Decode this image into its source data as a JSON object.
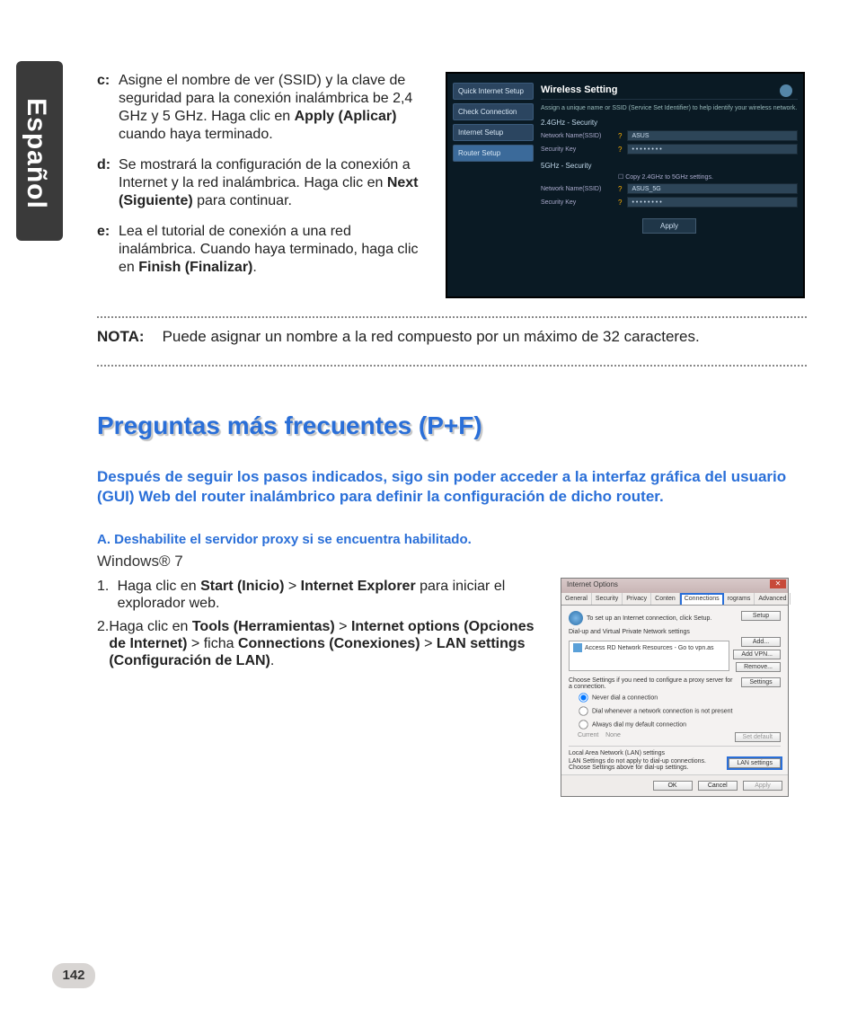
{
  "side_label": "Español",
  "steps": {
    "c_label": "c:",
    "c_text_1": "Asigne el nombre de ver (SSID) y la clave de seguridad para la conexión inalámbrica be 2,4 GHz y 5 GHz. Haga clic en ",
    "c_bold": "Apply (Aplicar)",
    "c_text_2": " cuando haya terminado.",
    "d_label": "d:",
    "d_text_1": "Se mostrará la configuración de la conexión a Internet y la red inalámbrica. Haga clic en ",
    "d_bold": "Next (Siguiente)",
    "d_text_2": " para continuar.",
    "e_label": "e:",
    "e_text_1": "Lea el tutorial de conexión a una red inalámbrica. Cuando haya terminado, haga clic en ",
    "e_bold": "Finish (Finalizar)",
    "e_text_2": "."
  },
  "router": {
    "sb1": "Quick Internet Setup",
    "sb2": "Check Connection",
    "sb3": "Internet Setup",
    "sb4": "Router Setup",
    "title": "Wireless Setting",
    "info": "Assign a unique name or SSID (Service Set Identifier) to help identify your wireless network.",
    "sec24": "2.4GHz - Security",
    "l_ssid": "Network Name(SSID)",
    "v_ssid24": "ASUS",
    "l_key": "Security Key",
    "v_key": "• • • • • • • •",
    "sec5": "5GHz - Security",
    "copy": "Copy 2.4GHz to 5GHz settings.",
    "v_ssid5": "ASUS_5G",
    "apply": "Apply"
  },
  "nota_label": "NOTA:",
  "nota_text": "Puede asignar un nombre a la red compuesto por un máximo de 32 caracteres.",
  "faq_heading": "Preguntas más frecuentes (P+F)",
  "faq_question": "Después de seguir los pasos indicados, sigo sin poder acceder a la interfaz gráfica del usuario (GUI) Web del router inalámbrico para definir la configuración de dicho router.",
  "faq_a": "A.   Deshabilite el servidor proxy si se encuentra habilitado.",
  "win7": "Windows® 7",
  "ol": {
    "n1": "1.",
    "t1a": "Haga clic en ",
    "t1b1": "Start (Inicio)",
    "t1gt1": " > ",
    "t1b2": "Internet Explorer",
    "t1c": " para iniciar el explorador web.",
    "n2": "2.",
    "t2a": "Haga clic en ",
    "t2b1": "Tools (Herramientas)",
    "t2gt1": " > ",
    "t2b2": "Internet options (Opciones de Internet)",
    "t2gt2": " > ",
    "t2mid": "ficha ",
    "t2b3": "Connections (Conexiones)",
    "t2gt3": " > ",
    "t2b4": "LAN settings (Configuración de LAN)",
    "t2end": "."
  },
  "win": {
    "title": "Internet Options",
    "tab_general": "General",
    "tab_security": "Security",
    "tab_privacy": "Privacy",
    "tab_content": "Conten",
    "tab_connections": "Connections",
    "tab_programs": "rograms",
    "tab_advanced": "Advanced",
    "setup_text": "To set up an Internet connection, click Setup.",
    "btn_setup": "Setup",
    "grp_dun": "Dial-up and Virtual Private Network settings",
    "list_item": "Access RD Network Resources - Go to vpn.as",
    "btn_add": "Add...",
    "btn_addvpn": "Add VPN...",
    "btn_remove": "Remove...",
    "choose": "Choose Settings if you need to configure a proxy server for a connection.",
    "btn_settings": "Settings",
    "r_never": "Never dial a connection",
    "r_whenever": "Dial whenever a network connection is not present",
    "r_always": "Always dial my default connection",
    "current": "Current",
    "none": "None",
    "btn_setdef": "Set default",
    "grp_lan": "Local Area Network (LAN) settings",
    "lan_text": "LAN Settings do not apply to dial-up connections. Choose Settings above for dial-up settings.",
    "btn_lan": "LAN settings",
    "btn_ok": "OK",
    "btn_cancel": "Cancel",
    "btn_apply": "Apply"
  },
  "page_number": "142"
}
